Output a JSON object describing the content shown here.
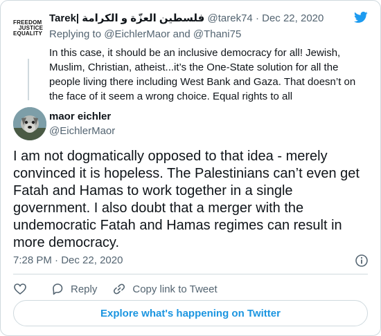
{
  "quoted": {
    "logo_lines": [
      "FREEDOM",
      "JUSTICE",
      "EQUALITY"
    ],
    "name": "Tarek| فلسطين العزّة و الكرامة",
    "handle": "@tarek74",
    "separator": "·",
    "date": "Dec 22, 2020",
    "replying_prefix": "Replying to",
    "reply_to_1": "@EichlerMaor",
    "reply_and": "and",
    "reply_to_2": "@Thani75",
    "text": "In this case, it should be an inclusive democracy for all! Jewish, Muslim, Christian, atheist...it’s the One-State solution for all the people living there including West Bank and Gaza. That doesn’t on the face of it seem a wrong choice. Equal rights to all"
  },
  "main": {
    "name": "maor eichler",
    "handle": "@EichlerMaor",
    "text": "I am not dogmatically opposed to that idea - merely convinced it is hopeless. The Palestinians can’t even get Fatah and Hamas to work together in a single government. I also doubt that a merger with the undemocratic Fatah and Hamas regimes can result in more democracy.",
    "time": "7:28 PM",
    "date": "Dec 22, 2020"
  },
  "actions": {
    "reply_label": "Reply",
    "copy_label": "Copy link to Tweet"
  },
  "explore_label": "Explore what's happening on Twitter",
  "colors": {
    "twitter_blue": "#1d9bf0",
    "link_blue": "#1b95e0",
    "muted": "#536471",
    "border": "#cfd9de"
  },
  "icons": [
    "twitter-bird-icon",
    "info-icon",
    "heart-icon",
    "reply-icon",
    "link-icon"
  ]
}
